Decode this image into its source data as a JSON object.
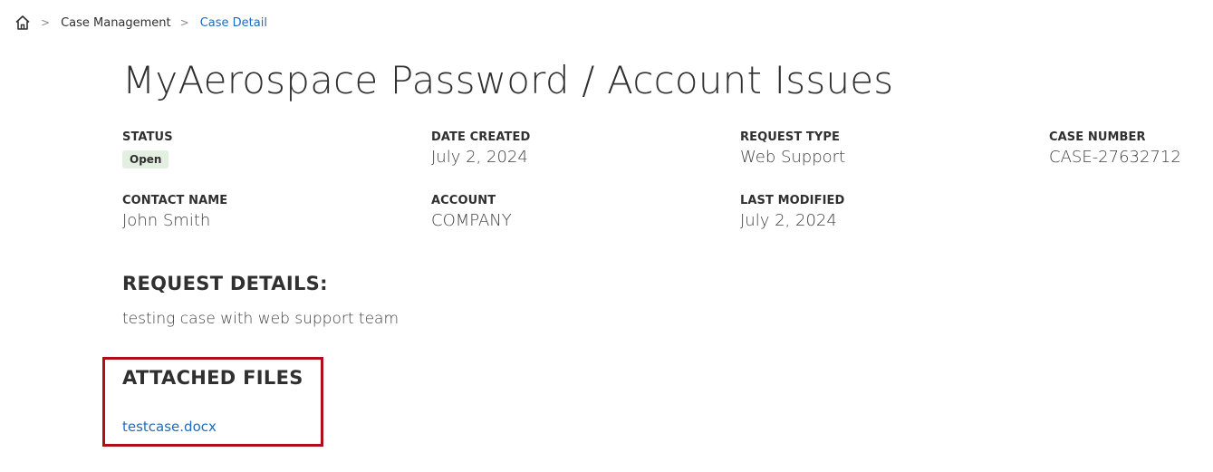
{
  "breadcrumb": {
    "home_icon": "home-icon",
    "separator": ">",
    "items": [
      {
        "label": "Case Management"
      },
      {
        "label": "Case Detail"
      }
    ]
  },
  "title": "MyAerospace Password / Account Issues",
  "fields": {
    "status": {
      "label": "STATUS",
      "value": "Open"
    },
    "date_created": {
      "label": "DATE CREATED",
      "value": "July 2, 2024"
    },
    "request_type": {
      "label": "REQUEST TYPE",
      "value": "Web Support"
    },
    "case_number": {
      "label": "CASE NUMBER",
      "value": "CASE-27632712"
    },
    "contact_name": {
      "label": "CONTACT NAME",
      "value": "John Smith"
    },
    "account": {
      "label": "ACCOUNT",
      "value": "COMPANY"
    },
    "last_modified": {
      "label": "LAST MODIFIED",
      "value": "July 2, 2024"
    }
  },
  "request_details": {
    "heading": "REQUEST DETAILS:",
    "text": "testing case with web support team"
  },
  "attached_files": {
    "heading": "ATTACHED FILES",
    "files": [
      {
        "name": "testcase.docx"
      }
    ]
  },
  "colors": {
    "link": "#1f6bbf",
    "highlight_border": "#b00d1b",
    "status_badge_bg": "#e3efe0"
  }
}
